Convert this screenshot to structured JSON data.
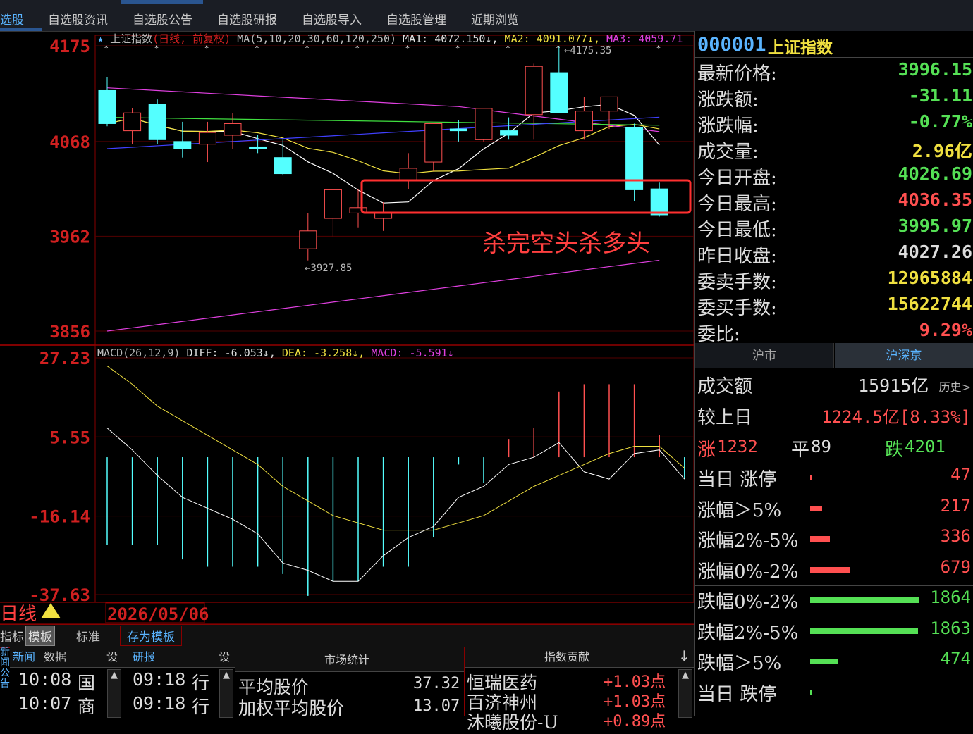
{
  "nav": {
    "items": [
      {
        "label": "选股",
        "active": true
      },
      {
        "label": "自选股资讯"
      },
      {
        "label": "自选股公告"
      },
      {
        "label": "自选股研报"
      },
      {
        "label": "自选股导入"
      },
      {
        "label": "自选股管理"
      },
      {
        "label": "近期浏览"
      }
    ]
  },
  "chart_data": [
    {
      "type": "candlestick",
      "title": "上证指数(日线, 前复权)",
      "ma_legend": "MA(5,10,20,30,60,120,250)",
      "ma1": "MA1: 4072.150",
      "ma2": "MA2: 4091.077",
      "ma3": "MA3: 4059.71",
      "ylim": [
        3856,
        4175
      ],
      "y_ticks": [
        "4175",
        "4068",
        "3962",
        "3856"
      ],
      "high_label": "4175.35",
      "low_label": "3927.85",
      "annotation": "杀完空头杀多头",
      "candles": [
        {
          "o": 4125,
          "h": 4140,
          "l": 4085,
          "c": 4088
        },
        {
          "o": 4080,
          "h": 4105,
          "l": 4065,
          "c": 4100
        },
        {
          "o": 4110,
          "h": 4115,
          "l": 4065,
          "c": 4070
        },
        {
          "o": 4068,
          "h": 4090,
          "l": 4050,
          "c": 4060
        },
        {
          "o": 4065,
          "h": 4090,
          "l": 4045,
          "c": 4078
        },
        {
          "o": 4075,
          "h": 4100,
          "l": 4060,
          "c": 4088
        },
        {
          "o": 4062,
          "h": 4075,
          "l": 4055,
          "c": 4060
        },
        {
          "o": 4050,
          "h": 4070,
          "l": 4030,
          "c": 4032
        },
        {
          "o": 3948,
          "h": 3988,
          "l": 3935,
          "c": 3968
        },
        {
          "o": 3982,
          "h": 4015,
          "l": 3962,
          "c": 4014
        },
        {
          "o": 3988,
          "h": 4015,
          "l": 3972,
          "c": 3994
        },
        {
          "o": 3982,
          "h": 4000,
          "l": 3968,
          "c": 3988
        },
        {
          "o": 4025,
          "h": 4055,
          "l": 4015,
          "c": 4038
        },
        {
          "o": 4045,
          "h": 4088,
          "l": 4035,
          "c": 4088
        },
        {
          "o": 4082,
          "h": 4092,
          "l": 4068,
          "c": 4080
        },
        {
          "o": 4070,
          "h": 4105,
          "l": 4068,
          "c": 4105
        },
        {
          "o": 4080,
          "h": 4095,
          "l": 4070,
          "c": 4075
        },
        {
          "o": 4098,
          "h": 4155,
          "l": 4070,
          "c": 4152
        },
        {
          "o": 4145,
          "h": 4175,
          "l": 4100,
          "c": 4100
        },
        {
          "o": 4080,
          "h": 4118,
          "l": 4070,
          "c": 4102
        },
        {
          "o": 4102,
          "h": 4118,
          "l": 4082,
          "c": 4118
        },
        {
          "o": 4084,
          "h": 4088,
          "l": 4001,
          "c": 4014
        },
        {
          "o": 4015,
          "h": 4022,
          "l": 3984,
          "c": 3986
        }
      ]
    },
    {
      "type": "bar",
      "title": "MACD(26,12,9)",
      "diff": "DIFF: -6.053",
      "dea": "DEA: -3.258",
      "macd": "MACD: -5.591",
      "ylim": [
        -37.63,
        27.23
      ],
      "y_ticks": [
        "27.23",
        "5.55",
        "-16.14",
        "-37.63"
      ],
      "values": [
        -24,
        -24,
        -24,
        -28,
        -30,
        -30,
        -30,
        -32,
        -38,
        -34,
        -34,
        -30,
        -30,
        -22,
        -2,
        -7,
        5,
        8,
        18,
        20,
        20,
        20,
        6,
        -6
      ],
      "diff_values": [
        8,
        2,
        -5,
        -11,
        -14,
        -17,
        -21,
        -29,
        -31,
        -34,
        -34,
        -27,
        -22,
        -19,
        -11,
        -8,
        -2,
        0,
        4,
        -4,
        -6,
        1,
        2,
        -6
      ],
      "dea_values": [
        25,
        20,
        14,
        10,
        6,
        2,
        -2,
        -8,
        -12,
        -16,
        -18,
        -20,
        -20,
        -20,
        -18,
        -16,
        -12,
        -8,
        -5,
        -2,
        1,
        3,
        3,
        -3
      ]
    }
  ],
  "footer": {
    "period_label": "日线",
    "date": "2026/05/06",
    "tabs": [
      "指标",
      "模板",
      "标准",
      "存为模板"
    ],
    "news_header": [
      "新闻",
      "数据",
      "设"
    ],
    "side_label": "新闻公告",
    "news": [
      {
        "time": "10:08",
        "tag": "国"
      },
      {
        "time": "10:07",
        "tag": "商"
      }
    ],
    "research_header": [
      "研报",
      "设"
    ],
    "research": [
      {
        "time": "09:18",
        "tag": "行"
      },
      {
        "time": "09:18",
        "tag": "行"
      }
    ],
    "market_stats_title": "市场统计",
    "market_stats": [
      {
        "label": "平均股价",
        "value": "37.32"
      },
      {
        "label": "加权平均股价",
        "value": "13.07"
      }
    ],
    "index_contrib_title": "指数贡献",
    "contrib": [
      {
        "name": "恒瑞医药",
        "value": "+1.03点"
      },
      {
        "name": "百济神州",
        "value": "+1.03点"
      },
      {
        "name": "沐曦股份-U",
        "value": "+0.89点"
      }
    ]
  },
  "quote": {
    "code": "000001",
    "name": "上证指数",
    "rows": [
      {
        "label": "最新价格:",
        "value": "3996.15",
        "color": "#55e055"
      },
      {
        "label": "涨跌额:",
        "value": "-31.11",
        "color": "#55e055"
      },
      {
        "label": "涨跌幅:",
        "value": "-0.77%",
        "color": "#55e055"
      },
      {
        "label": "成交量:",
        "value": "2.96亿",
        "color": "#f0e040"
      },
      {
        "label": "今日开盘:",
        "value": "4026.69",
        "color": "#55e055"
      },
      {
        "label": "今日最高:",
        "value": "4036.35",
        "color": "#ff5050"
      },
      {
        "label": "今日最低:",
        "value": "3995.97",
        "color": "#55e055"
      },
      {
        "label": "昨日收盘:",
        "value": "4027.26",
        "color": "#dddddd"
      },
      {
        "label": "委卖手数:",
        "value": "12965884",
        "color": "#f0e040"
      },
      {
        "label": "委买手数:",
        "value": "15622744",
        "color": "#f0e040"
      },
      {
        "label": "委比:",
        "value": "9.29%",
        "color": "#ff5050"
      }
    ]
  },
  "market": {
    "tabs": [
      "沪市",
      "沪深京"
    ],
    "turnover_label": "成交额",
    "turnover_value": "15915亿",
    "history_link": "历史>",
    "vs_label": "较上日",
    "vs_value": "1224.5亿[8.33%]",
    "up_label": "涨",
    "up_value": "1232",
    "flat_label": "平",
    "flat_value": "89",
    "down_label": "跌",
    "down_value": "4201",
    "stats": [
      {
        "label": "当日 涨停",
        "value": "47",
        "color": "#ff5050",
        "frac": 0.01
      },
      {
        "label": "涨幅＞5%",
        "value": "217",
        "color": "#ff5050",
        "frac": 0.11
      },
      {
        "label": "涨幅2%-5%",
        "value": "336",
        "color": "#ff5050",
        "frac": 0.18
      },
      {
        "label": "涨幅0%-2%",
        "value": "679",
        "color": "#ff5050",
        "frac": 0.36
      },
      {
        "label": "跌幅0%-2%",
        "value": "1864",
        "color": "#55e055",
        "frac": 1.0
      },
      {
        "label": "跌幅2%-5%",
        "value": "1863",
        "color": "#55e055",
        "frac": 0.99
      },
      {
        "label": "跌幅＞5%",
        "value": "474",
        "color": "#55e055",
        "frac": 0.25
      },
      {
        "label": "当日 跌停",
        "value": "",
        "color": "#55e055",
        "frac": 0.01
      }
    ]
  }
}
